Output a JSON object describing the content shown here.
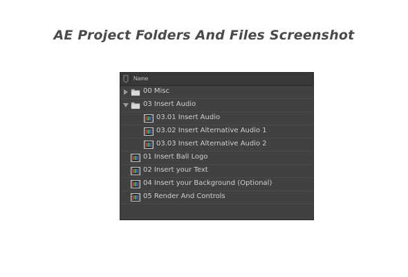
{
  "headline": "AE Project Folders And Files Screenshot",
  "panel": {
    "column_header": "Name",
    "items": [
      {
        "label": "00 Misc",
        "kind": "folder",
        "expanded": false,
        "depth": 0
      },
      {
        "label": "03 Insert Audio",
        "kind": "folder",
        "expanded": true,
        "depth": 0
      },
      {
        "label": "03.01 Insert Audio",
        "kind": "composition",
        "depth": 1
      },
      {
        "label": "03.02 Insert Alternative Audio 1",
        "kind": "composition",
        "depth": 1
      },
      {
        "label": "03.03 Insert Alternative Audio 2",
        "kind": "composition",
        "depth": 1
      },
      {
        "label": "01 Insert Ball Logo",
        "kind": "composition",
        "depth": 0
      },
      {
        "label": "02 Insert your Text",
        "kind": "composition",
        "depth": 0
      },
      {
        "label": "04 Insert your Background (Optional)",
        "kind": "composition",
        "depth": 0
      },
      {
        "label": "05 Render And Controls",
        "kind": "composition",
        "depth": 0
      }
    ]
  },
  "colors": {
    "panel_bg": "#414141",
    "row_divider": "#4a4a4a",
    "text": "#d0d0d0",
    "headline": "#4a4a4a"
  },
  "icons": {
    "collapsed": "triangle-right-icon",
    "expanded": "triangle-down-icon",
    "folder": "folder-icon",
    "composition": "composition-icon",
    "label": "label-tag-icon"
  }
}
